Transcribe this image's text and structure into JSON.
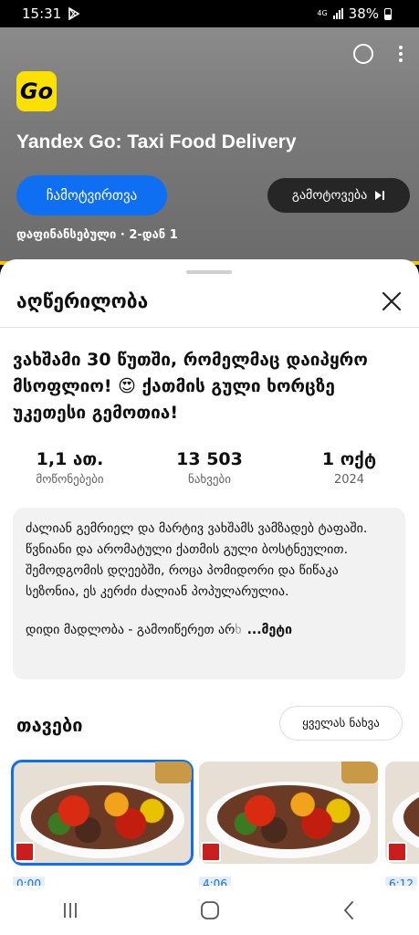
{
  "status_bar": {
    "time": "15:31",
    "network": "4G",
    "battery": "38%"
  },
  "ad": {
    "app_logo_text": "Go",
    "app_title": "Yandex Go: Taxi Food Delivery",
    "install_label": "ჩამოტვირთვა",
    "skip_label": "გამოტოვება",
    "sponsor_label": "დაფინანსებული · 2-დან 1"
  },
  "description_panel": {
    "title": "აღწერილობა",
    "video_title": "ვახშამი 30 წუთში, რომელმაც დაიპყრო მსოფლიო! 😍 ქათმის გული ხორცზე უკეთესი გემოთია!",
    "stats": [
      {
        "value": "1,1 ათ.",
        "label": "მოწონებები"
      },
      {
        "value": "13 503",
        "label": "ნახვები"
      },
      {
        "value": "1 ოქტ",
        "label": "2024"
      }
    ],
    "description": "ძალიან გემრიელ და მარტივ ვახშამს ვამზადებ ტაფაში. წვნიანი და არომატული ქათმის გული ბოსტნეულით. შემოდგომის დღეებში, როცა პომიდორი და წიწაკა სეზონია, ეს კერძი ძალიან პოპულარულია.",
    "description_more_prefix": "დიდი მადლობა - გამოიწერეთ არ",
    "description_more_faded": "ხ",
    "more_label": "...მეტი",
    "chapters_title": "თავები",
    "view_all_label": "ყველას ნახვა",
    "chapters": [
      {
        "time": "0:00"
      },
      {
        "time": "4:06"
      },
      {
        "time": "6:12"
      }
    ]
  },
  "colors": {
    "accent_blue": "#0f6ff2",
    "yandex_yellow": "#fce000"
  },
  "icons": [
    "play-store-icon",
    "circle-icon",
    "more-vert-icon",
    "skip-next-icon",
    "close-icon",
    "recent-apps-icon",
    "home-icon",
    "back-icon"
  ]
}
